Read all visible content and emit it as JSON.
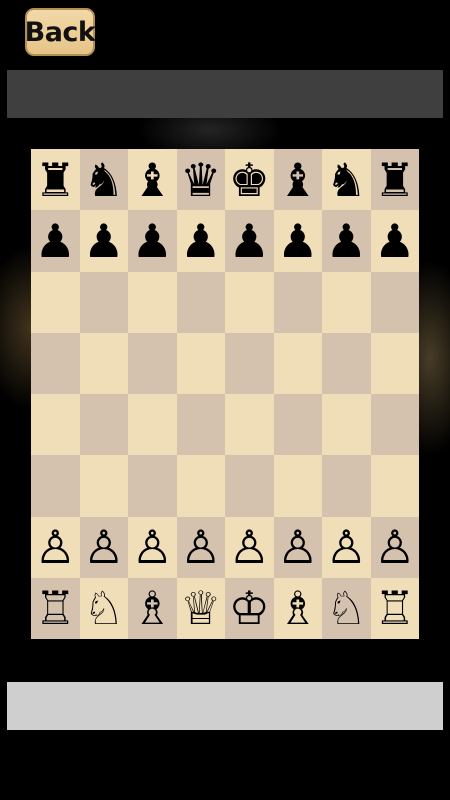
{
  "header": {
    "back_label": "Back"
  },
  "colors": {
    "light_square": "#f0deb9",
    "dark_square": "#d4c2ae",
    "top_bar": "#3f3f3f",
    "bottom_bar": "#cfcfcf",
    "back_button": "#e9c98f"
  },
  "board": {
    "ranks": [
      [
        {
          "piece": "black-rook",
          "glyph": "♜"
        },
        {
          "piece": "black-knight",
          "glyph": "♞"
        },
        {
          "piece": "black-bishop",
          "glyph": "♝"
        },
        {
          "piece": "black-queen",
          "glyph": "♛"
        },
        {
          "piece": "black-king",
          "glyph": "♚"
        },
        {
          "piece": "black-bishop",
          "glyph": "♝"
        },
        {
          "piece": "black-knight",
          "glyph": "♞"
        },
        {
          "piece": "black-rook",
          "glyph": "♜"
        }
      ],
      [
        {
          "piece": "black-pawn",
          "glyph": "♟"
        },
        {
          "piece": "black-pawn",
          "glyph": "♟"
        },
        {
          "piece": "black-pawn",
          "glyph": "♟"
        },
        {
          "piece": "black-pawn",
          "glyph": "♟"
        },
        {
          "piece": "black-pawn",
          "glyph": "♟"
        },
        {
          "piece": "black-pawn",
          "glyph": "♟"
        },
        {
          "piece": "black-pawn",
          "glyph": "♟"
        },
        {
          "piece": "black-pawn",
          "glyph": "♟"
        }
      ],
      [
        null,
        null,
        null,
        null,
        null,
        null,
        null,
        null
      ],
      [
        null,
        null,
        null,
        null,
        null,
        null,
        null,
        null
      ],
      [
        null,
        null,
        null,
        null,
        null,
        null,
        null,
        null
      ],
      [
        null,
        null,
        null,
        null,
        null,
        null,
        null,
        null
      ],
      [
        {
          "piece": "white-pawn",
          "glyph": "♙"
        },
        {
          "piece": "white-pawn",
          "glyph": "♙"
        },
        {
          "piece": "white-pawn",
          "glyph": "♙"
        },
        {
          "piece": "white-pawn",
          "glyph": "♙"
        },
        {
          "piece": "white-pawn",
          "glyph": "♙"
        },
        {
          "piece": "white-pawn",
          "glyph": "♙"
        },
        {
          "piece": "white-pawn",
          "glyph": "♙"
        },
        {
          "piece": "white-pawn",
          "glyph": "♙"
        }
      ],
      [
        {
          "piece": "white-rook",
          "glyph": "♖"
        },
        {
          "piece": "white-knight",
          "glyph": "♘"
        },
        {
          "piece": "white-bishop",
          "glyph": "♗"
        },
        {
          "piece": "white-queen",
          "glyph": "♕"
        },
        {
          "piece": "white-king",
          "glyph": "♔"
        },
        {
          "piece": "white-bishop",
          "glyph": "♗"
        },
        {
          "piece": "white-knight",
          "glyph": "♘"
        },
        {
          "piece": "white-rook",
          "glyph": "♖"
        }
      ]
    ]
  }
}
